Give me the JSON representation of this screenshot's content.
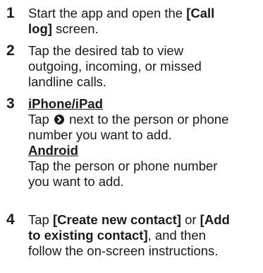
{
  "steps": [
    {
      "number": "1",
      "line1_a": "Start the app and open the ",
      "line1_b": "[Call",
      "line2_a": "log]",
      "line2_b": " screen."
    },
    {
      "number": "2",
      "line1": "Tap the desired tab to view",
      "line2": "outgoing, incoming, or missed",
      "line3": "landline calls."
    },
    {
      "number": "3",
      "ios_heading": "iPhone/iPad",
      "ios_line1_a": "Tap ",
      "ios_icon": "chevron-right-circle-icon",
      "ios_line1_b": " next to the person or phone",
      "ios_line2": "number you want to add.",
      "android_heading": "Android",
      "android_line1": "Tap the person or phone number",
      "android_line2": "you want to add."
    },
    {
      "number": "4",
      "line1_a": "Tap ",
      "line1_b": "[Create new contact]",
      "line1_c": " or ",
      "line1_d": "[Add",
      "line2_a": "to existing contact]",
      "line2_b": ", and then",
      "line3": "follow the on-screen instructions."
    }
  ]
}
